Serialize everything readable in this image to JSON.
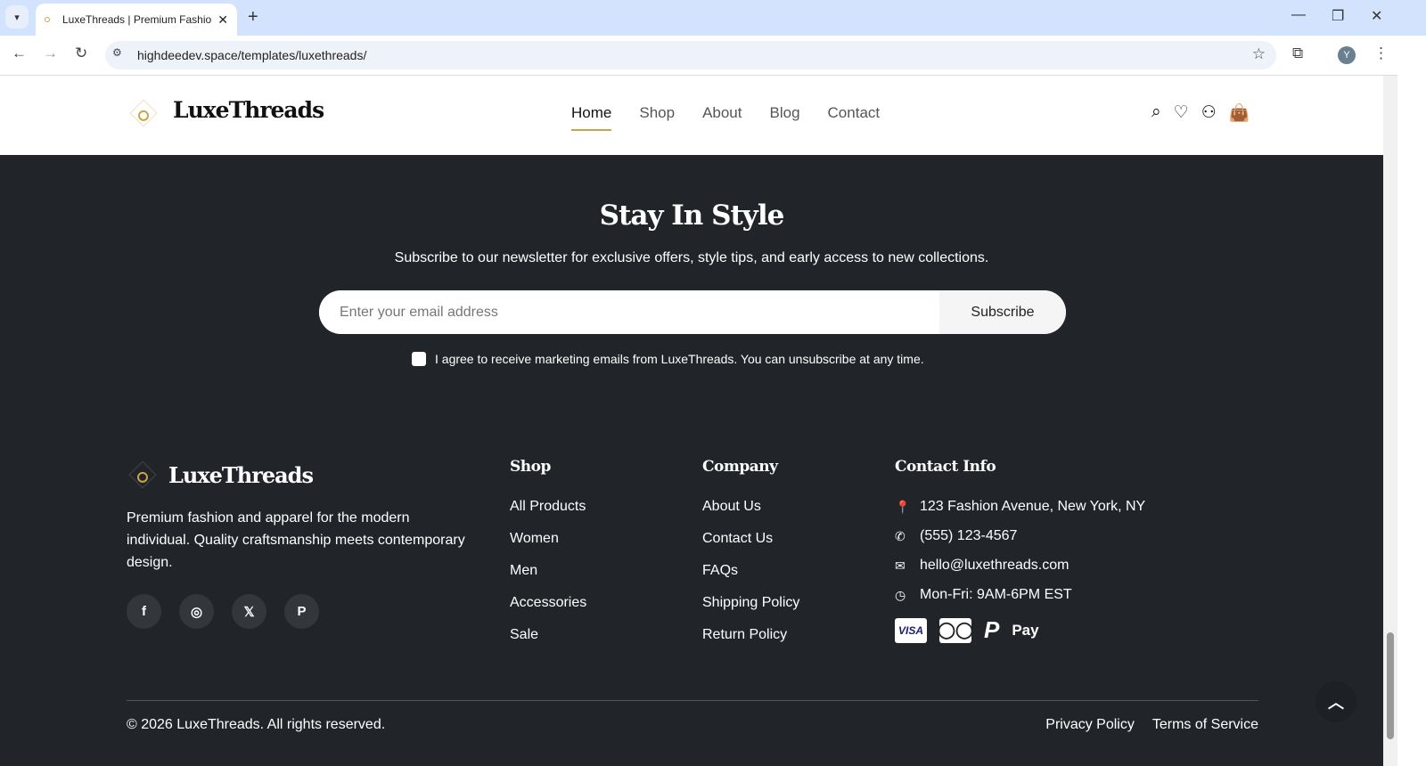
{
  "browser": {
    "tab_title": "LuxeThreads | Premium Fashion",
    "url": "highdeedev.space/templates/luxethreads/",
    "profile_initial": "Y"
  },
  "header": {
    "brand": "LuxeThreads",
    "nav": [
      "Home",
      "Shop",
      "About",
      "Blog",
      "Contact"
    ]
  },
  "newsletter": {
    "title": "Stay In Style",
    "subtitle": "Subscribe to our newsletter for exclusive offers, style tips, and early access to new collections.",
    "placeholder": "Enter your email address",
    "button": "Subscribe",
    "consent": "I agree to receive marketing emails from LuxeThreads. You can unsubscribe at any time."
  },
  "footer": {
    "brand": "LuxeThreads",
    "about": "Premium fashion and apparel for the modern individual. Quality craftsmanship meets contemporary design.",
    "shop": {
      "title": "Shop",
      "links": [
        "All Products",
        "Women",
        "Men",
        "Accessories",
        "Sale"
      ]
    },
    "company": {
      "title": "Company",
      "links": [
        "About Us",
        "Contact Us",
        "FAQs",
        "Shipping Policy",
        "Return Policy"
      ]
    },
    "contact": {
      "title": "Contact Info",
      "address": "123 Fashion Avenue, New York, NY",
      "phone": "(555) 123-4567",
      "email": "hello@luxethreads.com",
      "hours": "Mon-Fri: 9AM-6PM EST"
    },
    "payments": {
      "visa": "VISA",
      "applepay": "Pay"
    },
    "copyright": "© 2026 LuxeThreads. All rights reserved.",
    "legal": [
      "Privacy Policy",
      "Terms of Service"
    ]
  }
}
